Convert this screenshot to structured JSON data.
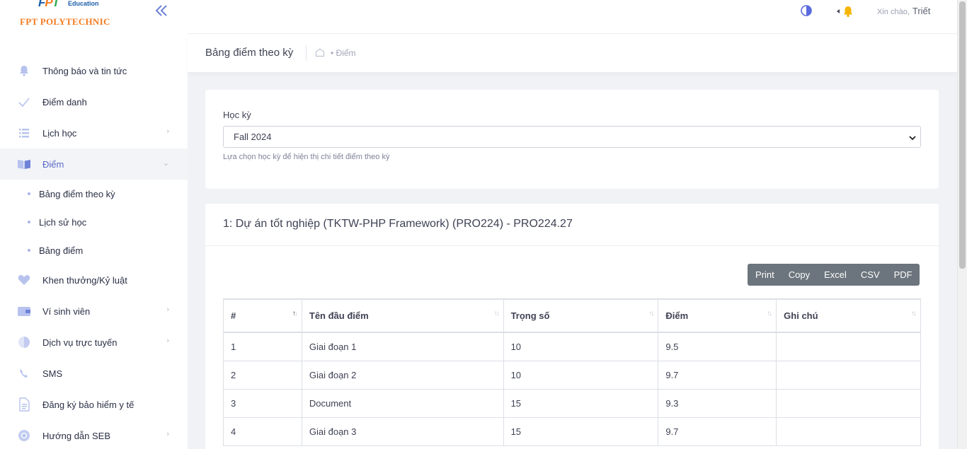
{
  "brand": {
    "fpt": [
      "F",
      "P",
      "T"
    ],
    "education": "Education",
    "name": "FPT POLYTECHNIC"
  },
  "sidebar": {
    "items": [
      {
        "label": "Thông báo và tin tức",
        "icon": "bell-icon"
      },
      {
        "label": "Điểm danh",
        "icon": "check-icon"
      },
      {
        "label": "Lịch học",
        "icon": "list-icon"
      },
      {
        "label": "Điểm",
        "icon": "book-icon"
      },
      {
        "label": "Khen thưởng/Kỷ luật",
        "icon": "heart-icon"
      },
      {
        "label": "Ví sinh viên",
        "icon": "wallet-icon"
      },
      {
        "label": "Dịch vụ trực tuyến",
        "icon": "globe-icon"
      },
      {
        "label": "SMS",
        "icon": "phone-icon"
      },
      {
        "label": "Đăng ký bảo hiểm y tế",
        "icon": "document-icon"
      },
      {
        "label": "Hướng dẫn SEB",
        "icon": "chrome-icon"
      }
    ],
    "sub_items": [
      {
        "label": "Bảng điểm theo kỳ"
      },
      {
        "label": "Lịch sử học"
      },
      {
        "label": "Bảng điểm"
      }
    ]
  },
  "header": {
    "greeting": "Xin chào,",
    "username": "Triết"
  },
  "subheader": {
    "title": "Bảng điểm theo kỳ",
    "breadcrumb": "• Điểm"
  },
  "semester": {
    "label": "Học kỳ",
    "selected": "Fall 2024",
    "hint": "Lựa chọn học kỳ để hiện thị chi tiết điểm theo kỳ"
  },
  "course": {
    "title": "1: Dự án tốt nghiệp (TKTW-PHP Framework) (PRO224) - PRO224.27",
    "export_buttons": [
      "Print",
      "Copy",
      "Excel",
      "CSV",
      "PDF"
    ],
    "columns": [
      "#",
      "Tên đầu điểm",
      "Trọng số",
      "Điểm",
      "Ghi chú"
    ],
    "rows": [
      [
        "1",
        "Giai đoạn 1",
        "10",
        "9.5",
        ""
      ],
      [
        "2",
        "Giai đoạn 2",
        "10",
        "9.7",
        ""
      ],
      [
        "3",
        "Document",
        "15",
        "9.3",
        ""
      ],
      [
        "4",
        "Giai đoạn 3",
        "15",
        "9.7",
        ""
      ]
    ]
  },
  "colors": {
    "accent": "#6e82d8",
    "export_bg": "#6c757d",
    "brand_orange": "#f47b20",
    "brand_blue": "#1b5faa"
  }
}
